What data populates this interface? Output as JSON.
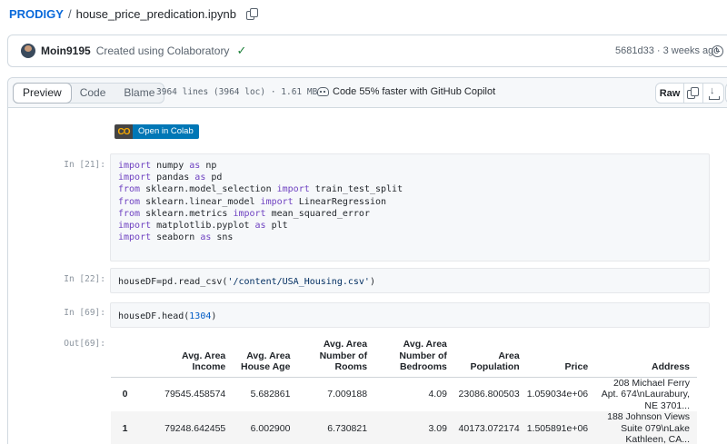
{
  "breadcrumb": {
    "repo": "PRODIGY",
    "separator": "/",
    "file": "house_price_predication.ipynb"
  },
  "commit": {
    "author": "Moin9195",
    "message": "Created using Colaboratory",
    "check": "✓",
    "meta": "5681d33 · 3 weeks ago",
    "history_label": "H"
  },
  "toolbar": {
    "tabs": [
      "Preview",
      "Code",
      "Blame"
    ],
    "file_info": "3964 lines (3964 loc) · 1.61 MB",
    "copilot": "Code 55% faster with GitHub Copilot",
    "raw": "Raw"
  },
  "colab_badge": {
    "logo": "CO",
    "label": "Open in Colab"
  },
  "cells": [
    {
      "prompt": "In [21]:",
      "lines": [
        [
          [
            "kw",
            "import"
          ],
          [
            "t",
            " numpy "
          ],
          [
            "kw",
            "as"
          ],
          [
            "t",
            " np"
          ]
        ],
        [
          [
            "kw",
            "import"
          ],
          [
            "t",
            " pandas "
          ],
          [
            "kw",
            "as"
          ],
          [
            "t",
            " pd"
          ]
        ],
        [
          [
            "kw",
            "from"
          ],
          [
            "t",
            " sklearn.model_selection "
          ],
          [
            "kw",
            "import"
          ],
          [
            "t",
            " train_test_split"
          ]
        ],
        [
          [
            "kw",
            "from"
          ],
          [
            "t",
            " sklearn.linear_model "
          ],
          [
            "kw",
            "import"
          ],
          [
            "t",
            " LinearRegression"
          ]
        ],
        [
          [
            "kw",
            "from"
          ],
          [
            "t",
            " sklearn.metrics "
          ],
          [
            "kw",
            "import"
          ],
          [
            "t",
            " mean_squared_error"
          ]
        ],
        [
          [
            "kw",
            "import"
          ],
          [
            "t",
            " matplotlib.pyplot "
          ],
          [
            "kw",
            "as"
          ],
          [
            "t",
            " plt"
          ]
        ],
        [
          [
            "kw",
            "import"
          ],
          [
            "t",
            " seaborn "
          ],
          [
            "kw",
            "as"
          ],
          [
            "t",
            " sns"
          ]
        ]
      ]
    },
    {
      "prompt": "In [22]:",
      "lines": [
        [
          [
            "t",
            "houseDF=pd.read_csv("
          ],
          [
            "str",
            "'/content/USA_Housing.csv'"
          ],
          [
            "t",
            ")"
          ]
        ]
      ]
    },
    {
      "prompt": "In [69]:",
      "lines": [
        [
          [
            "t",
            "houseDF.head("
          ],
          [
            "num",
            "1304"
          ],
          [
            "t",
            ")"
          ]
        ]
      ]
    }
  ],
  "output": {
    "prompt": "Out[69]:",
    "columns": [
      "",
      "Avg. Area Income",
      "Avg. Area House Age",
      "Avg. Area Number of Rooms",
      "Avg. Area Number of Bedrooms",
      "Area Population",
      "Price",
      "Address"
    ],
    "rows": [
      [
        "0",
        "79545.458574",
        "5.682861",
        "7.009188",
        "4.09",
        "23086.800503",
        "1.059034e+06",
        "208 Michael Ferry Apt. 674\\nLaurabury, NE 3701..."
      ],
      [
        "1",
        "79248.642455",
        "6.002900",
        "6.730821",
        "3.09",
        "40173.072174",
        "1.505891e+06",
        "188 Johnson Views Suite 079\\nLake Kathleen, CA..."
      ]
    ]
  }
}
